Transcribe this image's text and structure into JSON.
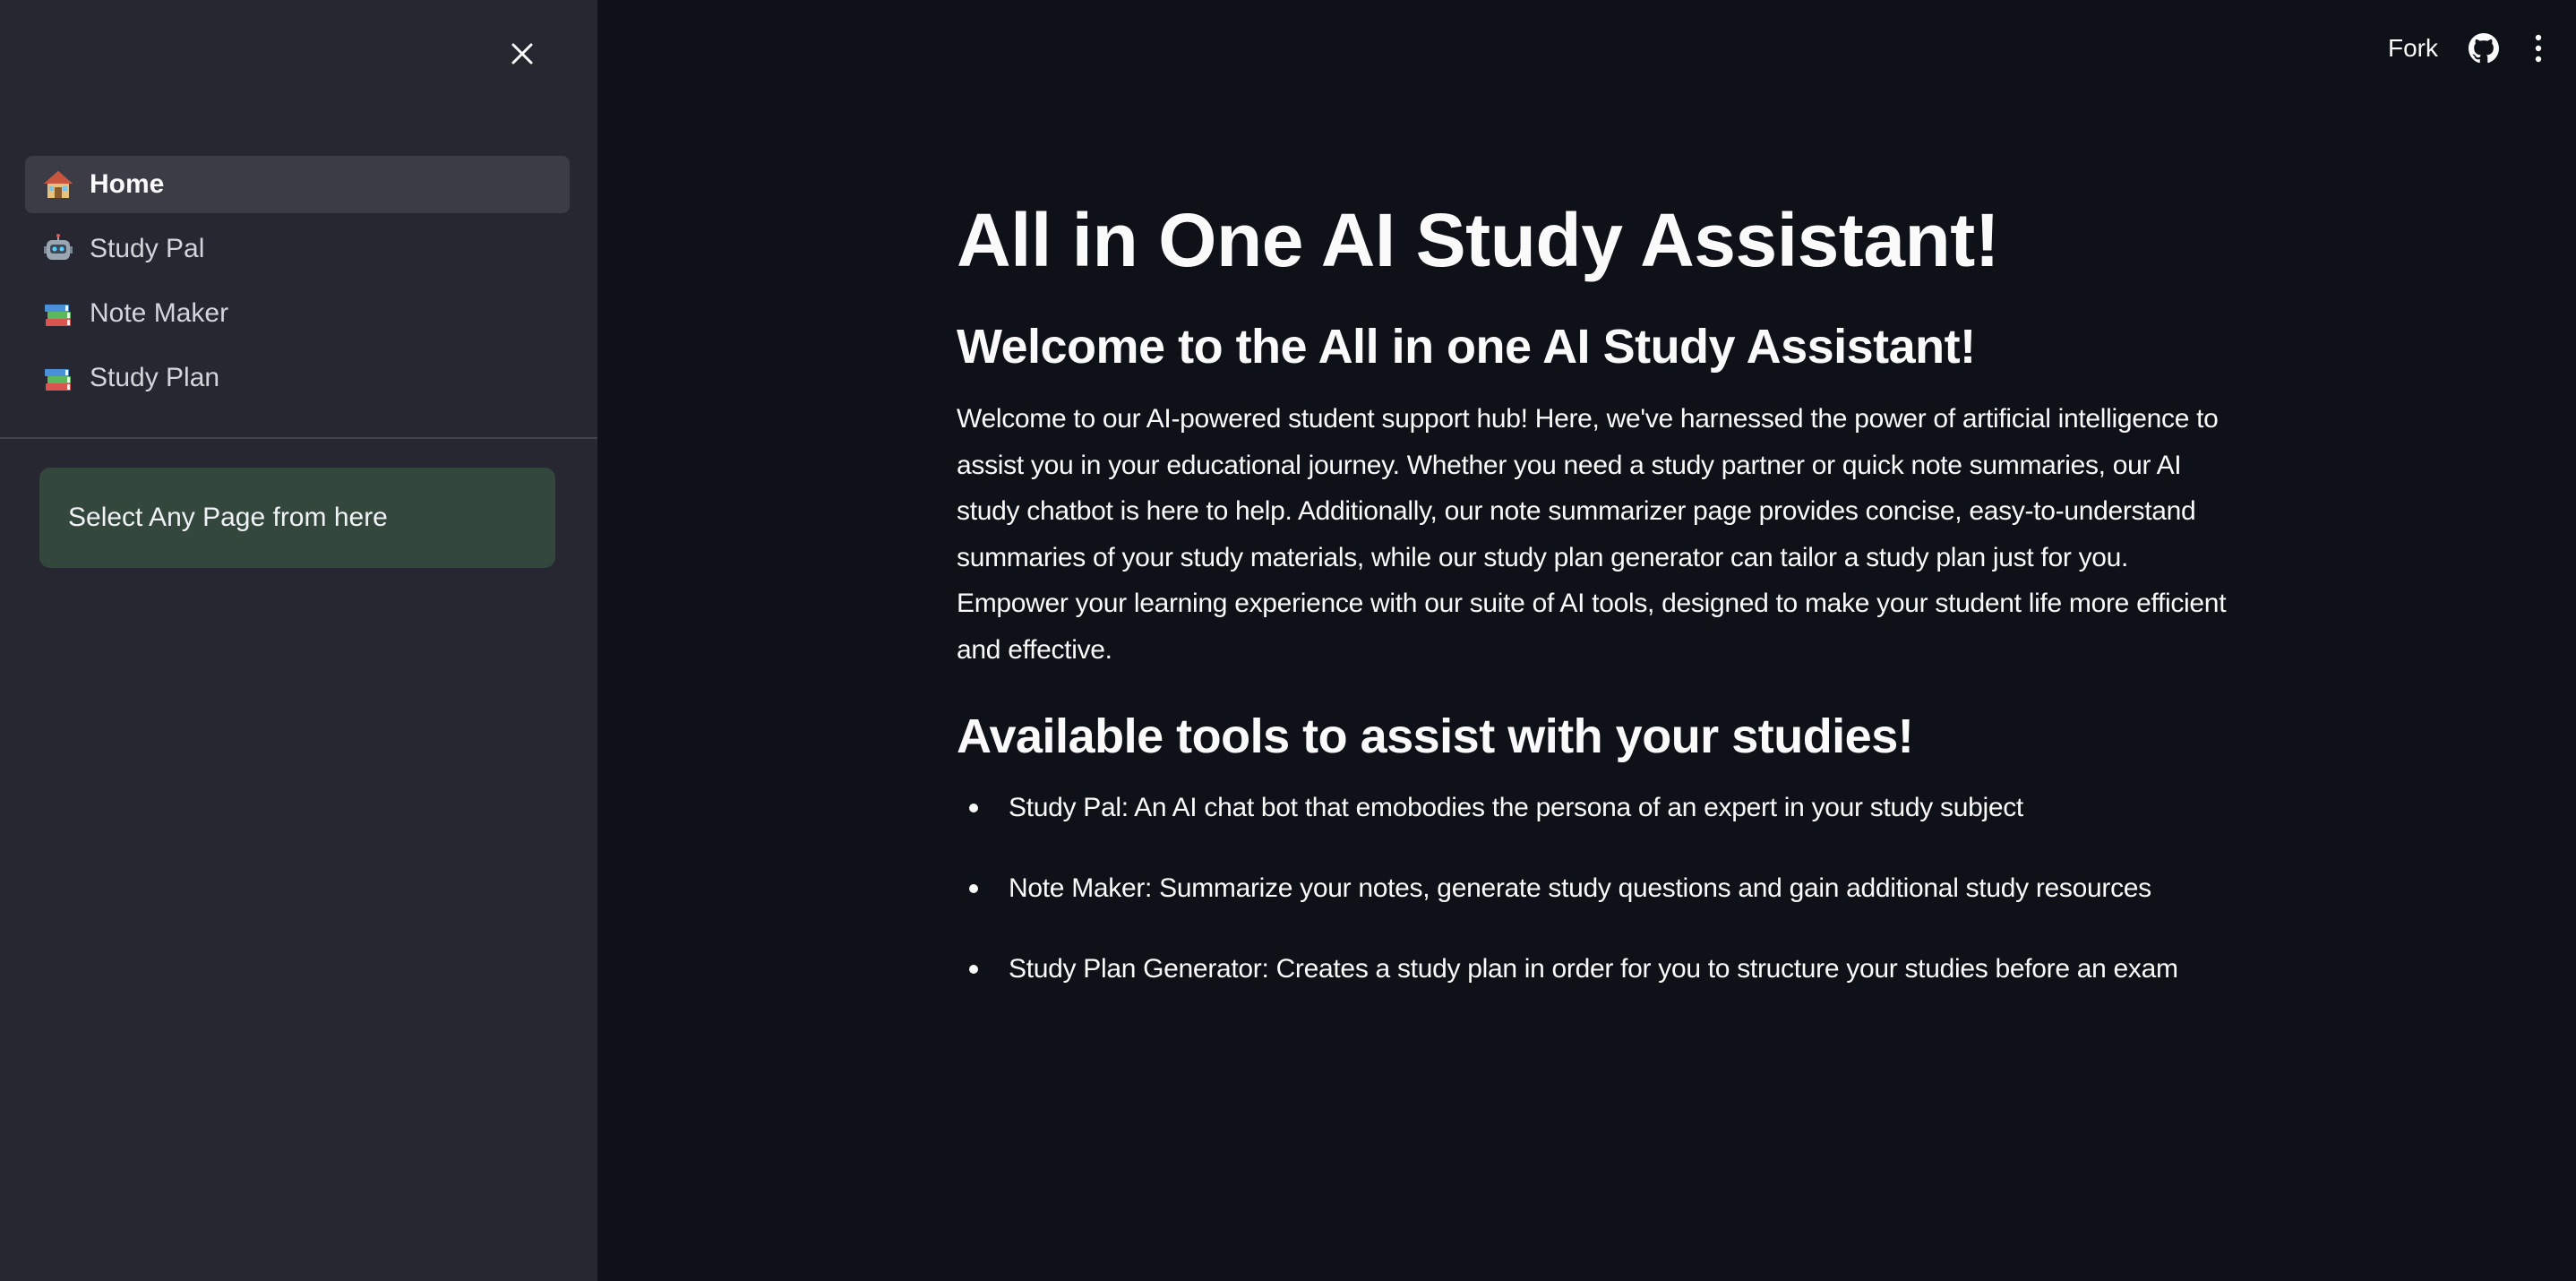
{
  "sidebar": {
    "nav_items": [
      {
        "icon": "house-icon",
        "emoji": "🏠",
        "label": "Home",
        "active": true
      },
      {
        "icon": "robot-icon",
        "emoji": "🤖",
        "label": "Study Pal",
        "active": false
      },
      {
        "icon": "books-icon",
        "emoji": "📚",
        "label": "Note Maker",
        "active": false
      },
      {
        "icon": "books-icon",
        "emoji": "📚",
        "label": "Study Plan",
        "active": false
      }
    ],
    "info_text": "Select Any Page from here"
  },
  "toolbar": {
    "fork_label": "Fork",
    "github_icon": "github-icon",
    "menu_icon": "vertical-dots-icon"
  },
  "main": {
    "title": "All in One AI Study Assistant!",
    "subtitle": "Welcome to the All in one AI Study Assistant!",
    "intro": "Welcome to our AI-powered student support hub! Here, we've harnessed the power of artificial intelligence to assist you in your educational journey. Whether you need a study partner or quick note summaries, our AI study chatbot is here to help. Additionally, our note summarizer page provides concise, easy-to-understand summaries of your study materials, while our study plan generator can tailor a study plan just for you. Empower your learning experience with our suite of AI tools, designed to make your student life more efficient and effective.",
    "tools_heading": "Available tools to assist with your studies!",
    "tools": [
      "Study Pal: An AI chat bot that emobodies the persona of an expert in your study subject",
      "Note Maker: Summarize your notes, generate study questions and gain additional study resources",
      "Study Plan Generator: Creates a study plan in order for you to structure your studies before an exam"
    ]
  },
  "colors": {
    "main_bg": "#0e1117",
    "sidebar_bg": "#262730",
    "active_nav_bg": "#3b3c46",
    "info_box_bg": "#33473d",
    "text": "#fafafa"
  }
}
